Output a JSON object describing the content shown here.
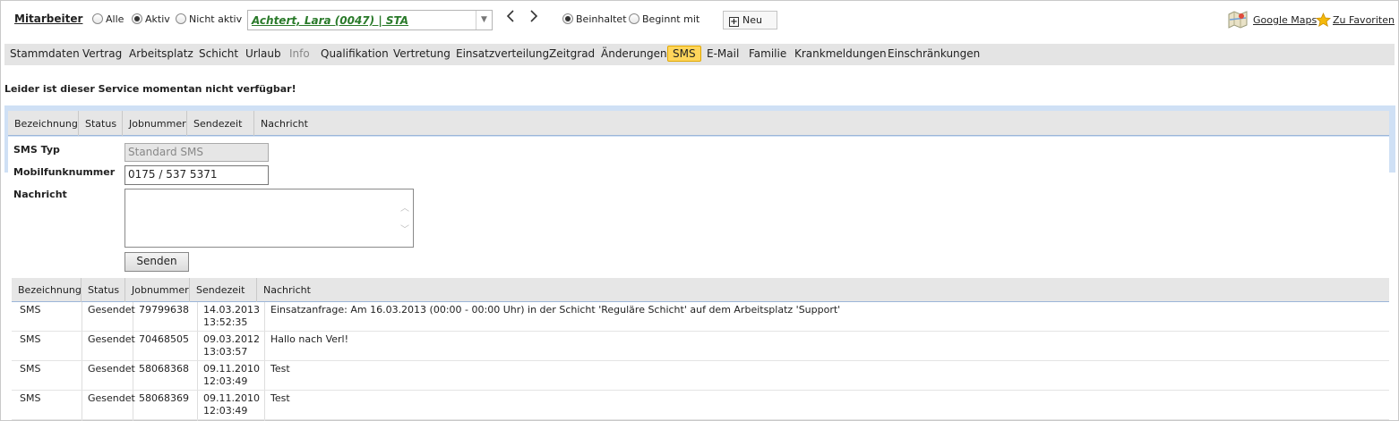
{
  "header": {
    "title": "Mitarbeiter",
    "filter_options": [
      {
        "label": "Alle",
        "checked": false
      },
      {
        "label": "Aktiv",
        "checked": true
      },
      {
        "label": "Nicht aktiv",
        "checked": false
      }
    ],
    "employee_select_value": "Achtert, Lara (0047) | STA",
    "search_modes": [
      {
        "label": "Beinhaltet",
        "checked": true
      },
      {
        "label": "Beginnt mit",
        "checked": false
      }
    ],
    "new_label": "Neu",
    "google_maps_label": "Google Maps",
    "favorites_label": "Zu Favoriten"
  },
  "tabs": [
    {
      "label": "Stammdaten",
      "state": "normal"
    },
    {
      "label": "Vertrag",
      "state": "normal"
    },
    {
      "label": "Arbeitsplatz",
      "state": "normal"
    },
    {
      "label": "Schicht",
      "state": "normal"
    },
    {
      "label": "Urlaub",
      "state": "normal"
    },
    {
      "label": "Info",
      "state": "disabled"
    },
    {
      "label": "Qualifikation",
      "state": "normal"
    },
    {
      "label": "Vertretung",
      "state": "normal"
    },
    {
      "label": "Einsatzverteilung",
      "state": "normal"
    },
    {
      "label": "Zeitgrad",
      "state": "normal"
    },
    {
      "label": "Änderungen",
      "state": "normal"
    },
    {
      "label": "SMS",
      "state": "active"
    },
    {
      "label": "E-Mail",
      "state": "normal"
    },
    {
      "label": "Familie",
      "state": "normal"
    },
    {
      "label": "Krankmeldungen",
      "state": "normal"
    },
    {
      "label": "Einschränkungen",
      "state": "normal"
    }
  ],
  "notice": "Leider ist dieser Service momentan nicht verfügbar!",
  "panel_headers": [
    "Bezeichnung",
    "Status",
    "Jobnummer",
    "Sendezeit",
    "Nachricht"
  ],
  "form": {
    "sms_type_label": "SMS Typ",
    "sms_type_value": "Standard SMS",
    "mobile_label": "Mobilfunknummer",
    "mobile_value": "0175 / 537 5371",
    "message_label": "Nachricht",
    "message_value": "",
    "send_label": "Senden"
  },
  "table": {
    "headers": [
      "Bezeichnung",
      "Status",
      "Jobnummer",
      "Sendezeit",
      "Nachricht"
    ],
    "rows": [
      {
        "bezeichnung": "SMS",
        "status": "Gesendet",
        "jobnummer": "79799638",
        "datum": "14.03.2013",
        "zeit": "13:52:35",
        "nachricht": "Einsatzanfrage: Am 16.03.2013 (00:00 - 00:00 Uhr) in der Schicht 'Reguläre Schicht' auf dem Arbeitsplatz 'Support'"
      },
      {
        "bezeichnung": "SMS",
        "status": "Gesendet",
        "jobnummer": "70468505",
        "datum": "09.03.2012",
        "zeit": "13:03:57",
        "nachricht": "Hallo nach Verl!"
      },
      {
        "bezeichnung": "SMS",
        "status": "Gesendet",
        "jobnummer": "58068368",
        "datum": "09.11.2010",
        "zeit": "12:03:49",
        "nachricht": "Test"
      },
      {
        "bezeichnung": "SMS",
        "status": "Gesendet",
        "jobnummer": "58068369",
        "datum": "09.11.2010",
        "zeit": "12:03:49",
        "nachricht": "Test"
      }
    ]
  }
}
